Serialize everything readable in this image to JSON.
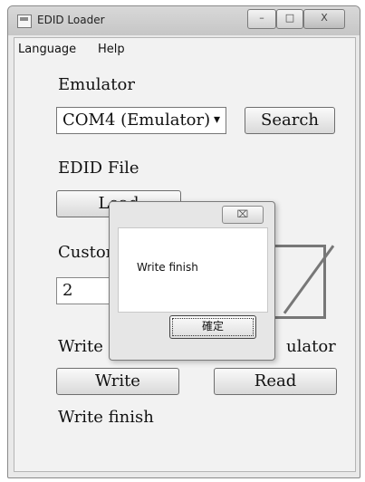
{
  "window": {
    "title": "EDID Loader",
    "min_glyph": "–",
    "max_glyph": "□",
    "close_glyph": "X"
  },
  "menu": [
    "Language",
    "Help"
  ],
  "emulator": {
    "label": "Emulator",
    "selected": "COM4 (Emulator)",
    "arrow": "▾",
    "search_label": "Search"
  },
  "edid_file": {
    "label": "EDID File",
    "load_label": "Load"
  },
  "custom": {
    "label": "Custom I",
    "value": "2"
  },
  "write_section": {
    "label_left": "Write em",
    "label_right": "ulator",
    "write_label": "Write",
    "read_label": "Read"
  },
  "status_text": "Write finish",
  "dialog": {
    "close_glyph": "⌧",
    "message": "Write finish",
    "ok_label": "確定"
  }
}
